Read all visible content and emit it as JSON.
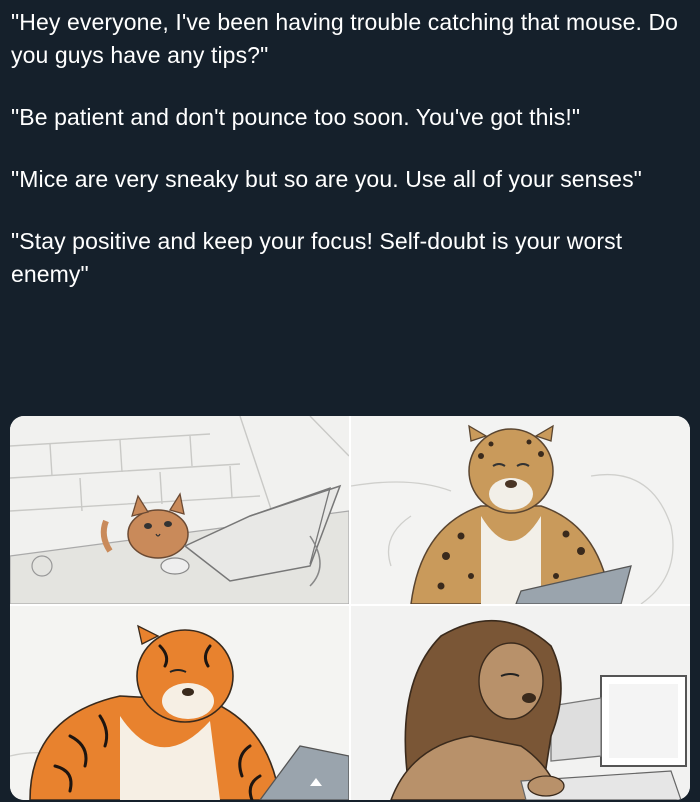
{
  "tweet": {
    "paragraphs": [
      "\"Hey everyone, I've been having trouble catching that mouse. Do you guys have any tips?\"",
      "\"Be patient and don't pounce too soon. You've got this!\"",
      "\"Mice are very sneaky but so are you. Use all of your senses\"",
      "\"Stay positive and keep your focus! Self-doubt is your worst enemy\""
    ]
  },
  "comic": {
    "panels": [
      {
        "subject": "house cat at laptop",
        "icon": "cat-illustration"
      },
      {
        "subject": "leopard at laptop",
        "icon": "leopard-illustration"
      },
      {
        "subject": "tiger at laptop",
        "icon": "tiger-illustration"
      },
      {
        "subject": "lion at laptop",
        "icon": "lion-illustration"
      }
    ],
    "colors": {
      "background": "#15202b",
      "tiger_orange": "#e8822e",
      "leopard_tan": "#c99a5b",
      "lion_brown": "#8a6a4a",
      "cat_orange": "#c98a5a"
    }
  }
}
